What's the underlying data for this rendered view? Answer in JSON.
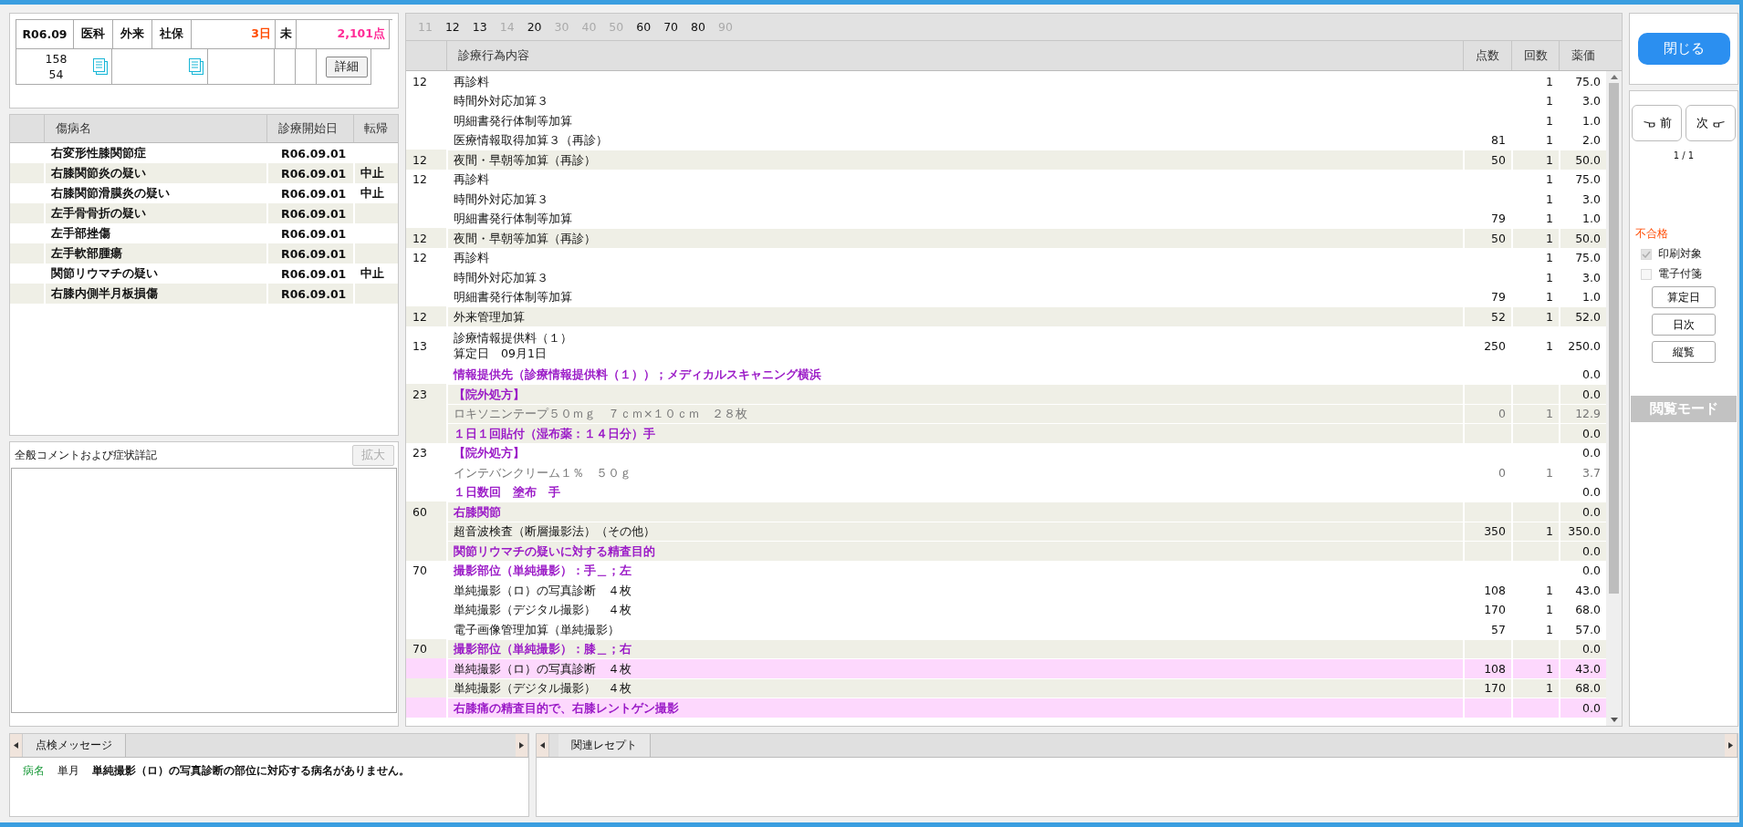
{
  "summary": {
    "cells": [
      {
        "text": "R06.09"
      },
      {
        "text": "医科"
      },
      {
        "text": "外来"
      },
      {
        "text": "社保"
      },
      {
        "text": "3日",
        "color": "#ff4a00"
      },
      {
        "text": "未"
      },
      {
        "text": "2,101点",
        "color": "#ff2a96"
      }
    ],
    "counts": [
      "158",
      "54"
    ],
    "detail_button": "詳細"
  },
  "diseases": {
    "columns": [
      "傷病名",
      "診療開始日",
      "転帰"
    ],
    "rows": [
      {
        "name": "右変形性膝関節症",
        "start": "R06.09.01",
        "outcome": ""
      },
      {
        "name": "右膝関節炎の疑い",
        "start": "R06.09.01",
        "outcome": "中止"
      },
      {
        "name": "右膝関節滑膜炎の疑い",
        "start": "R06.09.01",
        "outcome": "中止"
      },
      {
        "name": "左手骨骨折の疑い",
        "start": "R06.09.01",
        "outcome": ""
      },
      {
        "name": "左手部挫傷",
        "start": "R06.09.01",
        "outcome": ""
      },
      {
        "name": "左手軟部腫瘍",
        "start": "R06.09.01",
        "outcome": ""
      },
      {
        "name": "関節リウマチの疑い",
        "start": "R06.09.01",
        "outcome": "中止"
      },
      {
        "name": "右膝内側半月板損傷",
        "start": "R06.09.01",
        "outcome": ""
      }
    ]
  },
  "comment_panel": {
    "title": "全般コメントおよび症状詳記",
    "expand_button": "拡大",
    "expand_disabled": true
  },
  "code_tabs": [
    {
      "label": "11",
      "enabled": false
    },
    {
      "label": "12",
      "enabled": true
    },
    {
      "label": "13",
      "enabled": true
    },
    {
      "label": "14",
      "enabled": false
    },
    {
      "label": "20",
      "enabled": true
    },
    {
      "label": "30",
      "enabled": false
    },
    {
      "label": "40",
      "enabled": false
    },
    {
      "label": "50",
      "enabled": false
    },
    {
      "label": "60",
      "enabled": true
    },
    {
      "label": "70",
      "enabled": true
    },
    {
      "label": "80",
      "enabled": true
    },
    {
      "label": "90",
      "enabled": false
    }
  ],
  "table": {
    "columns": [
      "診療行為内容",
      "点数",
      "回数",
      "薬価"
    ],
    "rows": [
      {
        "code": "12",
        "lines": [
          "再診料"
        ],
        "points": "",
        "count": "1",
        "price": "75.0",
        "color": "#ffffff",
        "kind": "normal"
      },
      {
        "code": "",
        "lines": [
          "時間外対応加算３"
        ],
        "points": "",
        "count": "1",
        "price": "3.0",
        "color": "#ffffff",
        "kind": "normal"
      },
      {
        "code": "",
        "lines": [
          "明細書発行体制等加算"
        ],
        "points": "",
        "count": "1",
        "price": "1.0",
        "color": "#ffffff",
        "kind": "normal"
      },
      {
        "code": "",
        "lines": [
          "医療情報取得加算３（再診）"
        ],
        "points": "81",
        "count": "1",
        "price": "2.0",
        "color": "#ffffff",
        "kind": "normal"
      },
      {
        "code": "12",
        "lines": [
          "夜間・早朝等加算（再診）"
        ],
        "points": "50",
        "count": "1",
        "price": "50.0",
        "color": "#efefe6",
        "kind": "normal"
      },
      {
        "code": "12",
        "lines": [
          "再診料"
        ],
        "points": "",
        "count": "1",
        "price": "75.0",
        "color": "#ffffff",
        "kind": "normal"
      },
      {
        "code": "",
        "lines": [
          "時間外対応加算３"
        ],
        "points": "",
        "count": "1",
        "price": "3.0",
        "color": "#ffffff",
        "kind": "normal"
      },
      {
        "code": "",
        "lines": [
          "明細書発行体制等加算"
        ],
        "points": "79",
        "count": "1",
        "price": "1.0",
        "color": "#ffffff",
        "kind": "normal"
      },
      {
        "code": "12",
        "lines": [
          "夜間・早朝等加算（再診）"
        ],
        "points": "50",
        "count": "1",
        "price": "50.0",
        "color": "#efefe6",
        "kind": "normal"
      },
      {
        "code": "12",
        "lines": [
          "再診料"
        ],
        "points": "",
        "count": "1",
        "price": "75.0",
        "color": "#ffffff",
        "kind": "normal"
      },
      {
        "code": "",
        "lines": [
          "時間外対応加算３"
        ],
        "points": "",
        "count": "1",
        "price": "3.0",
        "color": "#ffffff",
        "kind": "normal"
      },
      {
        "code": "",
        "lines": [
          "明細書発行体制等加算"
        ],
        "points": "79",
        "count": "1",
        "price": "1.0",
        "color": "#ffffff",
        "kind": "normal"
      },
      {
        "code": "12",
        "lines": [
          "外来管理加算"
        ],
        "points": "52",
        "count": "1",
        "price": "52.0",
        "color": "#efefe6",
        "kind": "normal"
      },
      {
        "code": "13",
        "lines": [
          "診療情報提供料（１）",
          "算定日　09月1日"
        ],
        "points": "250",
        "count": "1",
        "price": "250.0",
        "color": "#ffffff",
        "kind": "normal"
      },
      {
        "code": "",
        "lines": [
          "情報提供先（診療情報提供料（１））；メディカルスキャニング横浜"
        ],
        "points": "",
        "count": "",
        "price": "0.0",
        "color": "#ffffff",
        "kind": "comment"
      },
      {
        "code": "23",
        "lines": [
          "【院外処方】"
        ],
        "points": "",
        "count": "",
        "price": "0.0",
        "color": "#efefe6",
        "kind": "comment"
      },
      {
        "code": "",
        "lines": [
          "ロキソニンテープ５０ｍｇ　７ｃｍ×１０ｃｍ　２８枚"
        ],
        "points": "0",
        "count": "1",
        "price": "12.9",
        "color": "#efefe6",
        "kind": "drug"
      },
      {
        "code": "",
        "lines": [
          "１日１回貼付（湿布薬：１４日分）手"
        ],
        "points": "",
        "count": "",
        "price": "0.0",
        "color": "#efefe6",
        "kind": "comment"
      },
      {
        "code": "23",
        "lines": [
          "【院外処方】"
        ],
        "points": "",
        "count": "",
        "price": "0.0",
        "color": "#ffffff",
        "kind": "comment"
      },
      {
        "code": "",
        "lines": [
          "インテバンクリーム１％　５０ｇ"
        ],
        "points": "0",
        "count": "1",
        "price": "3.7",
        "color": "#ffffff",
        "kind": "drug"
      },
      {
        "code": "",
        "lines": [
          "１日数回　塗布　手"
        ],
        "points": "",
        "count": "",
        "price": "0.0",
        "color": "#ffffff",
        "kind": "comment"
      },
      {
        "code": "60",
        "lines": [
          "右膝関節"
        ],
        "points": "",
        "count": "",
        "price": "0.0",
        "color": "#efefe6",
        "kind": "comment"
      },
      {
        "code": "",
        "lines": [
          "超音波検査（断層撮影法）（その他）"
        ],
        "points": "350",
        "count": "1",
        "price": "350.0",
        "color": "#efefe6",
        "kind": "normal"
      },
      {
        "code": "",
        "lines": [
          "関節リウマチの疑いに対する精査目的"
        ],
        "points": "",
        "count": "",
        "price": "0.0",
        "color": "#efefe6",
        "kind": "comment"
      },
      {
        "code": "70",
        "lines": [
          "撮影部位（単純撮影）：手＿；左"
        ],
        "points": "",
        "count": "",
        "price": "0.0",
        "color": "#ffffff",
        "kind": "comment"
      },
      {
        "code": "",
        "lines": [
          "単純撮影（ロ）の写真診断　４枚"
        ],
        "points": "108",
        "count": "1",
        "price": "43.0",
        "color": "#ffffff",
        "kind": "normal"
      },
      {
        "code": "",
        "lines": [
          "単純撮影（デジタル撮影）　４枚"
        ],
        "points": "170",
        "count": "1",
        "price": "68.0",
        "color": "#ffffff",
        "kind": "normal"
      },
      {
        "code": "",
        "lines": [
          "電子画像管理加算（単純撮影）"
        ],
        "points": "57",
        "count": "1",
        "price": "57.0",
        "color": "#ffffff",
        "kind": "normal"
      },
      {
        "code": "70",
        "lines": [
          "撮影部位（単純撮影）：膝＿；右"
        ],
        "points": "",
        "count": "",
        "price": "0.0",
        "color": "#efefe6",
        "kind": "comment"
      },
      {
        "code": "",
        "lines": [
          "単純撮影（ロ）の写真診断　４枚"
        ],
        "points": "108",
        "count": "1",
        "price": "43.0",
        "color": "#fdd8fd",
        "kind": "normal"
      },
      {
        "code": "",
        "lines": [
          "単純撮影（デジタル撮影）　４枚"
        ],
        "points": "170",
        "count": "1",
        "price": "68.0",
        "color": "#efefe6",
        "kind": "normal"
      },
      {
        "code": "",
        "lines": [
          "右膝痛の精査目的で、右膝レントゲン撮影"
        ],
        "points": "",
        "count": "",
        "price": "0.0",
        "color": "#fdd8fd",
        "kind": "comment"
      }
    ]
  },
  "side": {
    "close_button": "閉じる",
    "prev_button": "前",
    "next_button": "次",
    "page": "1 / 1",
    "status": "不合格",
    "checks": [
      {
        "label": "印刷対象",
        "checked": true,
        "disabled": true
      },
      {
        "label": "電子付箋",
        "checked": false,
        "disabled": true
      }
    ],
    "buttons": [
      "算定日",
      "日次",
      "縦覧"
    ],
    "mode": "閲覧モード"
  },
  "messages": {
    "tab": "点検メッセージ",
    "rows": [
      {
        "category": "病名",
        "period": "単月",
        "text": "単純撮影（ロ）の写真診断の部位に対応する病名がありません。"
      }
    ]
  },
  "related": {
    "tab": "関連レセプト"
  }
}
